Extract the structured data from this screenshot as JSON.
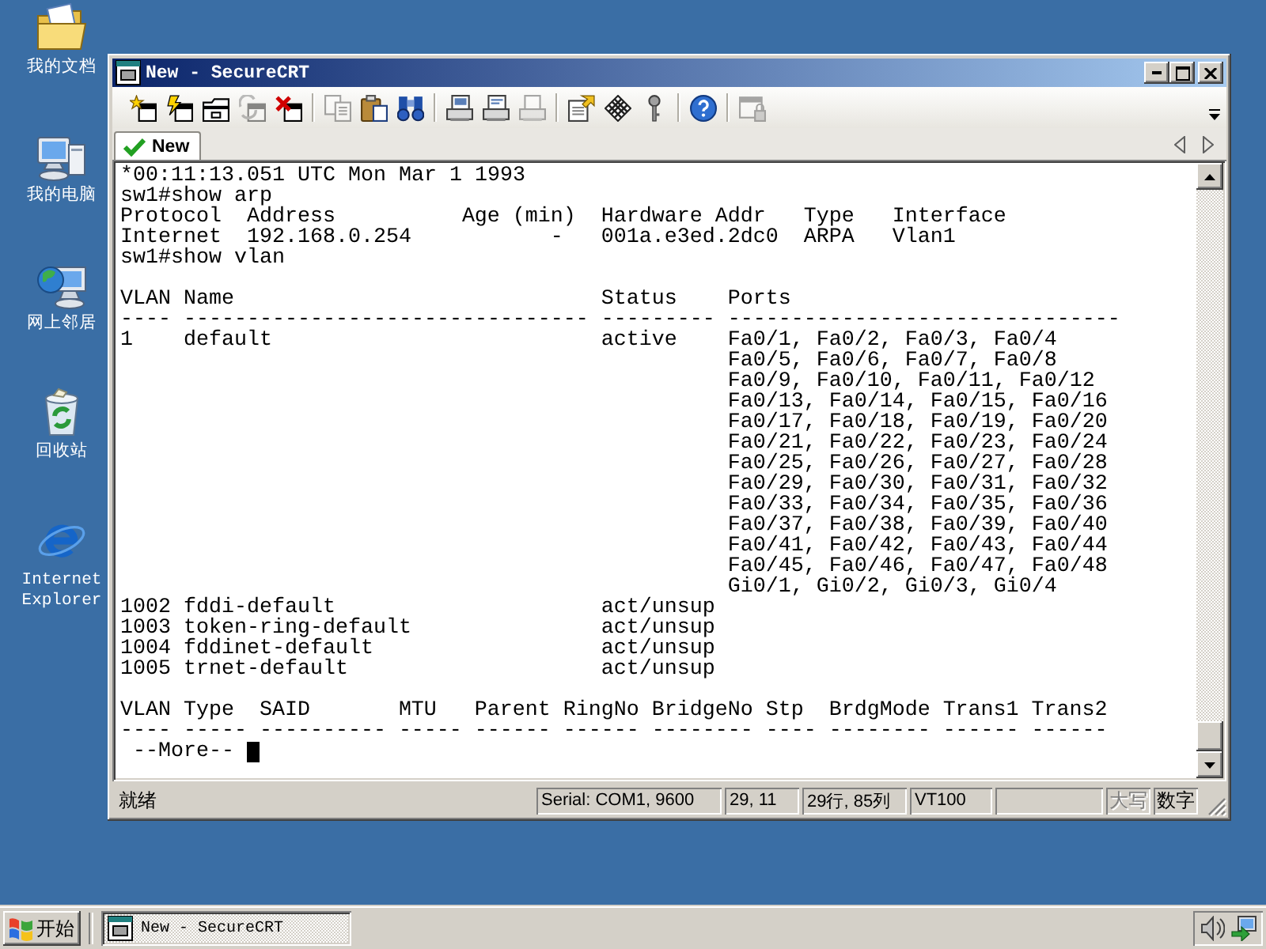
{
  "desktop_icons": [
    {
      "kind": "documents",
      "label": "我的文档"
    },
    {
      "kind": "computer",
      "label": "我的电脑"
    },
    {
      "kind": "network",
      "label": "网上邻居"
    },
    {
      "kind": "recycle_bin",
      "label": "回收站"
    },
    {
      "kind": "browser",
      "label": "Internet Explorer"
    }
  ],
  "window": {
    "title": "New - SecureCRT"
  },
  "toolbar": {
    "groups": [
      [
        {
          "kind": "connect",
          "disabled": false
        },
        {
          "kind": "quick_connect",
          "disabled": false
        },
        {
          "kind": "connect_in_tab",
          "disabled": false
        },
        {
          "kind": "reconnect",
          "disabled": true
        },
        {
          "kind": "disconnect",
          "disabled": false
        }
      ],
      [
        {
          "kind": "copy",
          "disabled": true
        },
        {
          "kind": "paste",
          "disabled": false
        },
        {
          "kind": "find",
          "disabled": false
        }
      ],
      [
        {
          "kind": "print_screen",
          "disabled": false
        },
        {
          "kind": "print_selection",
          "disabled": false
        },
        {
          "kind": "print",
          "disabled": true
        }
      ],
      [
        {
          "kind": "session_options",
          "disabled": false
        },
        {
          "kind": "global_options",
          "disabled": false
        },
        {
          "kind": "keymap",
          "disabled": false
        }
      ],
      [
        {
          "kind": "help",
          "disabled": false
        }
      ],
      [
        {
          "kind": "lock_session",
          "disabled": true
        }
      ]
    ]
  },
  "tabs": [
    {
      "label": "New",
      "selected": true,
      "connected": true
    }
  ],
  "terminal": {
    "log_lines": [
      "*00:11:13.051 UTC Mon Mar 1 1993",
      "sw1#show arp"
    ],
    "arp_table": {
      "columns": [
        "Protocol",
        "Address",
        "Age (min)",
        "Hardware Addr",
        "Type",
        "Interface"
      ],
      "rows": [
        [
          "Internet",
          "192.168.0.254",
          "-",
          "001a.e3ed.2dc0",
          "ARPA",
          "Vlan1"
        ]
      ]
    },
    "command": "sw1#show vlan",
    "vlan_table": {
      "columns": [
        "VLAN",
        "Name",
        "Status",
        "Ports"
      ],
      "rule": [
        "----",
        "--------------------------------",
        "---------",
        "-------------------------------"
      ],
      "rows": [
        {
          "vlan": "1",
          "name": "default",
          "status": "active",
          "ports": [
            "Fa0/1, Fa0/2, Fa0/3, Fa0/4",
            "Fa0/5, Fa0/6, Fa0/7, Fa0/8",
            "Fa0/9, Fa0/10, Fa0/11, Fa0/12",
            "Fa0/13, Fa0/14, Fa0/15, Fa0/16",
            "Fa0/17, Fa0/18, Fa0/19, Fa0/20",
            "Fa0/21, Fa0/22, Fa0/23, Fa0/24",
            "Fa0/25, Fa0/26, Fa0/27, Fa0/28",
            "Fa0/29, Fa0/30, Fa0/31, Fa0/32",
            "Fa0/33, Fa0/34, Fa0/35, Fa0/36",
            "Fa0/37, Fa0/38, Fa0/39, Fa0/40",
            "Fa0/41, Fa0/42, Fa0/43, Fa0/44",
            "Fa0/45, Fa0/46, Fa0/47, Fa0/48",
            "Gi0/1, Gi0/2, Gi0/3, Gi0/4"
          ]
        },
        {
          "vlan": "1002",
          "name": "fddi-default",
          "status": "act/unsup"
        },
        {
          "vlan": "1003",
          "name": "token-ring-default",
          "status": "act/unsup"
        },
        {
          "vlan": "1004",
          "name": "fddinet-default",
          "status": "act/unsup"
        },
        {
          "vlan": "1005",
          "name": "trnet-default",
          "status": "act/unsup"
        }
      ]
    },
    "vlan_type_table": {
      "columns": [
        "VLAN",
        "Type",
        "SAID",
        "MTU",
        "Parent",
        "RingNo",
        "BridgeNo",
        "Stp",
        "BrdgMode",
        "Trans1",
        "Trans2"
      ],
      "rule": [
        "----",
        "-----",
        "----------",
        "-----",
        "------",
        "------",
        "--------",
        "----",
        "--------",
        "------",
        "------"
      ]
    },
    "more_prompt": "--More--"
  },
  "status_bar": {
    "message": "就绪",
    "panes": [
      {
        "kind": "text",
        "text": "Serial: COM1, 9600"
      },
      {
        "kind": "text",
        "text": "29, 11"
      },
      {
        "kind": "text",
        "text": "29行, 85列"
      },
      {
        "kind": "text",
        "text": "VT100"
      },
      {
        "kind": "blank"
      }
    ],
    "indicators": [
      {
        "label": "大写",
        "on": false
      },
      {
        "label": "数字",
        "on": true
      }
    ]
  },
  "taskbar": {
    "start_button": {
      "label": "开始"
    },
    "tasks": [
      {
        "label": "New - SecureCRT",
        "selected": true
      }
    ]
  }
}
